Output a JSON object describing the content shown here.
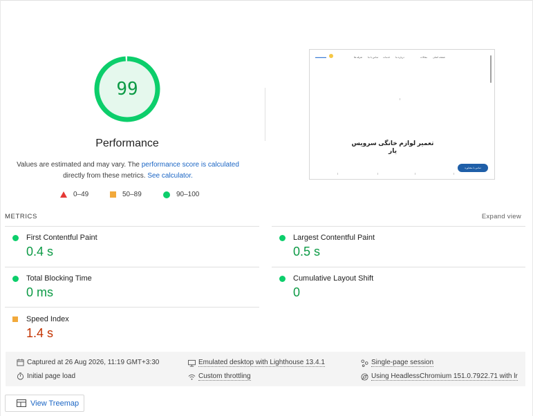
{
  "gauge": {
    "score": "99",
    "score_value": 99,
    "title": "Performance",
    "color": "#0cce6b",
    "fill": "#e5f8ed"
  },
  "description": {
    "prefix": "Values are estimated and may vary. The ",
    "link1": "performance score is calculated",
    "middle": "directly from these metrics. ",
    "link2": "See calculator."
  },
  "legend": [
    {
      "shape": "triangle",
      "label": "0–49",
      "color": "#e53935"
    },
    {
      "shape": "square",
      "label": "50–89",
      "color": "#f2a93b"
    },
    {
      "shape": "circle",
      "label": "90–100",
      "color": "#0cce6b"
    }
  ],
  "thumbnail": {
    "heading": "تعمیر لوازم خانگی سرویس یار",
    "nav": [
      "صفحه اصلی",
      "مقالات",
      "درباره ما",
      "خدمات",
      "تماس با ما",
      "تعرفه ها"
    ],
    "button": "تماس با مشاوره"
  },
  "metrics": {
    "section_label": "METRICS",
    "expand_label": "Expand view",
    "items": [
      {
        "name": "First Contentful Paint",
        "value": "0.4 s",
        "status": "pass"
      },
      {
        "name": "Largest Contentful Paint",
        "value": "0.5 s",
        "status": "pass"
      },
      {
        "name": "Total Blocking Time",
        "value": "0 ms",
        "status": "pass"
      },
      {
        "name": "Cumulative Layout Shift",
        "value": "0",
        "status": "pass"
      },
      {
        "name": "Speed Index",
        "value": "1.4 s",
        "status": "average"
      }
    ]
  },
  "runtime": {
    "captured": "Captured at 26 Aug 2026, 11:19 GMT+3:30",
    "load": "Initial page load",
    "device": "Emulated desktop with Lighthouse 13.4.1",
    "throttling": "Custom throttling",
    "session": "Single-page session",
    "browser": "Using HeadlessChromium 151.0.7922.71 with lr"
  },
  "treemap": {
    "label": "View Treemap"
  }
}
